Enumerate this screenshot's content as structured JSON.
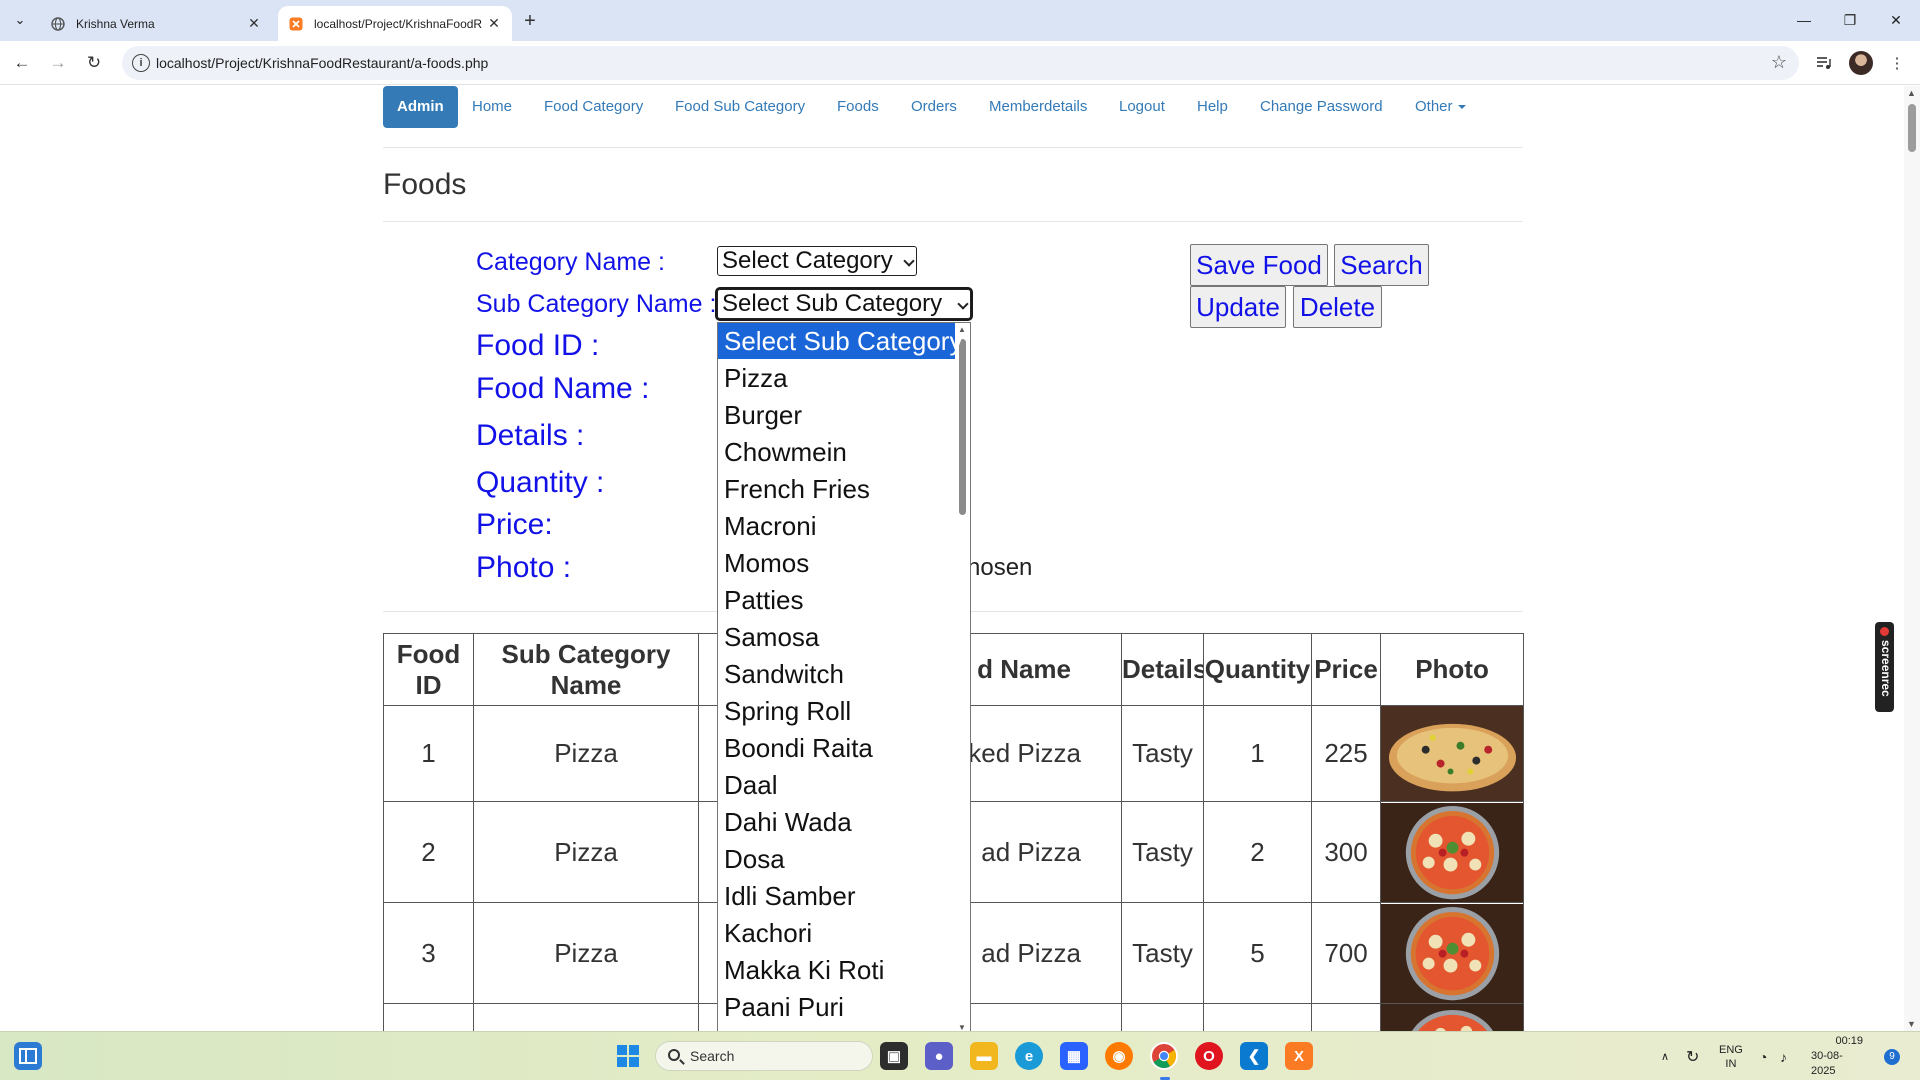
{
  "browser": {
    "tabs": [
      {
        "title": "Krishna Verma",
        "active": false
      },
      {
        "title": "localhost/Project/KrishnaFoodR",
        "active": true
      }
    ],
    "url": "localhost/Project/KrishnaFoodRestaurant/a-foods.php"
  },
  "nav": {
    "admin": "Admin",
    "items": [
      "Home",
      "Food Category",
      "Food Sub Category",
      "Foods",
      "Orders",
      "Memberdetails",
      "Logout",
      "Help",
      "Change Password"
    ],
    "other": "Other"
  },
  "page": {
    "title": "Foods"
  },
  "form": {
    "labels": {
      "category": "Category Name :",
      "subcategory": "Sub Category Name :",
      "food_id": "Food ID :",
      "food_name": "Food Name :",
      "details": "Details :",
      "quantity": "Quantity :",
      "price": "Price:",
      "photo": "Photo :"
    },
    "category_select": "Select Category",
    "subcategory_select": "Select Sub Category",
    "photo_status_visible": "hosen",
    "buttons": {
      "save": "Save Food",
      "search": "Search",
      "update": "Update",
      "delete": "Delete"
    }
  },
  "dropdown": {
    "options": [
      "Select Sub Category",
      "Pizza",
      "Burger",
      "Chowmein",
      "French Fries",
      "Macroni",
      "Momos",
      "Patties",
      "Samosa",
      "Sandwitch",
      "Spring Roll",
      "Boondi Raita",
      "Daal",
      "Dahi Wada",
      "Dosa",
      "Idli Samber",
      "Kachori",
      "Makka Ki Roti",
      "Paani Puri"
    ],
    "selected_index": 0
  },
  "table": {
    "headers": {
      "food_id_1": "Food",
      "food_id_2": "ID",
      "sub_1": "Sub Category",
      "sub_2": "Name",
      "name_visible": "d Name",
      "details": "Details",
      "quantity": "Quantity",
      "price": "Price",
      "photo": "Photo"
    },
    "rows": [
      {
        "id": "1",
        "sub": "Pizza",
        "name_visible": "ked Pizza",
        "details": "Tasty",
        "quantity": "1",
        "price": "225"
      },
      {
        "id": "2",
        "sub": "Pizza",
        "name_visible": "ad Pizza",
        "details": "Tasty",
        "quantity": "2",
        "price": "300"
      },
      {
        "id": "3",
        "sub": "Pizza",
        "name_visible": "ad Pizza",
        "details": "Tasty",
        "quantity": "5",
        "price": "700"
      }
    ]
  },
  "screenrec": "screenrec",
  "taskbar": {
    "search": "Search",
    "lang_1": "ENG",
    "lang_2": "IN",
    "time": "00:19",
    "date": "30-08-2025",
    "badge": "9"
  },
  "colors": {
    "link": "#337ab7",
    "form_text": "#1212e8",
    "selected_option": "#1a66d8"
  }
}
